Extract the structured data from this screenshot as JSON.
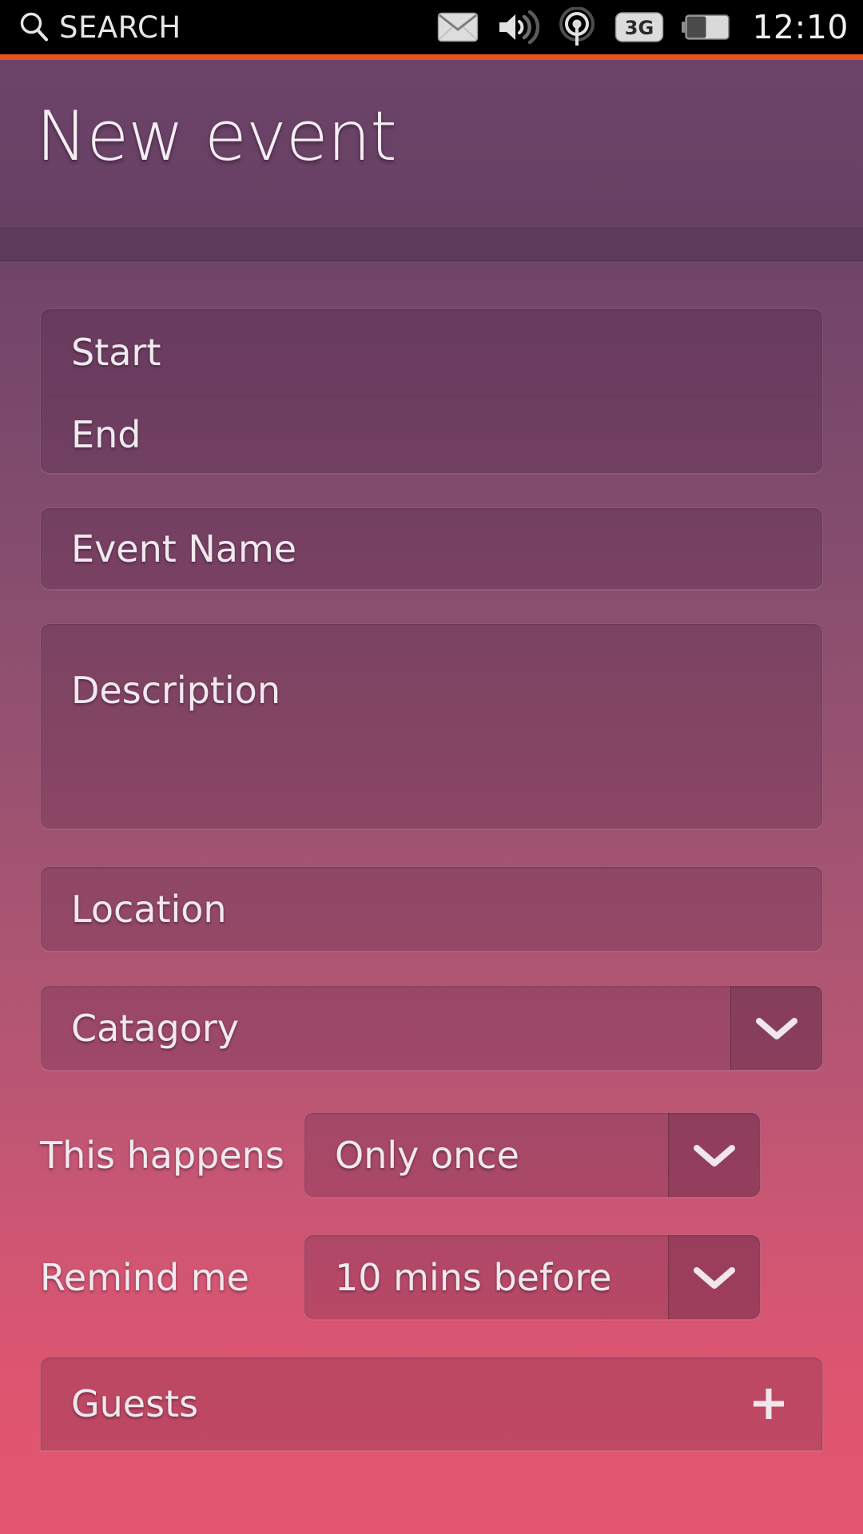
{
  "statusbar": {
    "search_label": "SEARCH",
    "search_icon": "search-icon",
    "clock": "12:10",
    "icons": [
      {
        "name": "message-icon",
        "label": "Messages"
      },
      {
        "name": "volume-icon",
        "label": "Sound"
      },
      {
        "name": "cellular-signal-icon",
        "label": "Signal"
      },
      {
        "name": "network-3g-icon",
        "label": "3G"
      },
      {
        "name": "battery-icon",
        "label": "Battery"
      }
    ],
    "network_label": "3G"
  },
  "header": {
    "title": "New event"
  },
  "form": {
    "start": {
      "label": "Start"
    },
    "end": {
      "label": "End"
    },
    "event_name": {
      "label": "Event Name"
    },
    "description": {
      "label": "Description"
    },
    "location": {
      "label": "Location"
    },
    "category": {
      "label": "Catagory",
      "chevron": "chevron-down-icon"
    },
    "this_happens": {
      "label": "This happens",
      "value": "Only once",
      "chevron": "chevron-down-icon"
    },
    "remind_me": {
      "label": "Remind me",
      "value": "10 mins before",
      "chevron": "chevron-down-icon"
    },
    "guests": {
      "label": "Guests",
      "add_icon": "plus-icon"
    }
  },
  "colors": {
    "accent_orange": "#e8521f",
    "header_purple": "#6d4469",
    "background_top": "#6a4468",
    "background_bottom": "#e4566f",
    "status_bar": "#000000",
    "text_light": "#f0e9ee"
  }
}
